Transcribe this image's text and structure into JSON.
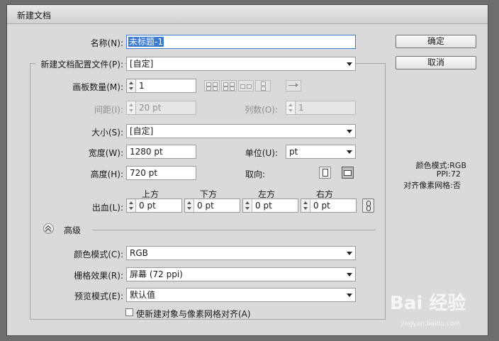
{
  "window": {
    "title": "新建文档"
  },
  "buttons": {
    "ok": "确定",
    "cancel": "取消"
  },
  "name": {
    "label": "名称(N):",
    "value": "未标题-1"
  },
  "profile": {
    "label": "新建文档配置文件(P):",
    "value": "[自定]"
  },
  "artboards": {
    "label": "画板数量(M):",
    "value": "1"
  },
  "spacing": {
    "label": "间距(I):",
    "value": "20 pt"
  },
  "columns": {
    "label": "列数(O):",
    "value": "1"
  },
  "size": {
    "label": "大小(S):",
    "value": "[自定]"
  },
  "width": {
    "label": "宽度(W):",
    "value": "1280 pt"
  },
  "units": {
    "label": "单位(U):",
    "value": "pt"
  },
  "height": {
    "label": "高度(H):",
    "value": "720 pt"
  },
  "orientation": {
    "label": "取向:"
  },
  "bleed": {
    "label": "出血(L):",
    "top": {
      "label": "上方",
      "value": "0 pt"
    },
    "bottom": {
      "label": "下方",
      "value": "0 pt"
    },
    "left": {
      "label": "左方",
      "value": "0 pt"
    },
    "right": {
      "label": "右方",
      "value": "0 pt"
    }
  },
  "advanced": {
    "label": "高级",
    "color_mode": {
      "label": "颜色模式(C):",
      "value": "RGB"
    },
    "raster_effects": {
      "label": "栅格效果(R):",
      "value": "屏幕 (72 ppi)"
    },
    "preview_mode": {
      "label": "预览模式(E):",
      "value": "默认值"
    },
    "align_pixel_grid": {
      "label": "使新建对象与像素网格对齐(A)",
      "checked": false
    }
  },
  "summary": {
    "color_mode": "颜色模式:RGB",
    "ppi": "PPI:72",
    "align_grid": "对齐像素网格:否"
  },
  "watermark": {
    "logo": "Bai 经验",
    "url": "jingyan.baidu.com"
  },
  "colors": {
    "selection": "#3d7bd0",
    "dialog_bg": "#dadada",
    "backdrop": "#6e6e6e"
  }
}
